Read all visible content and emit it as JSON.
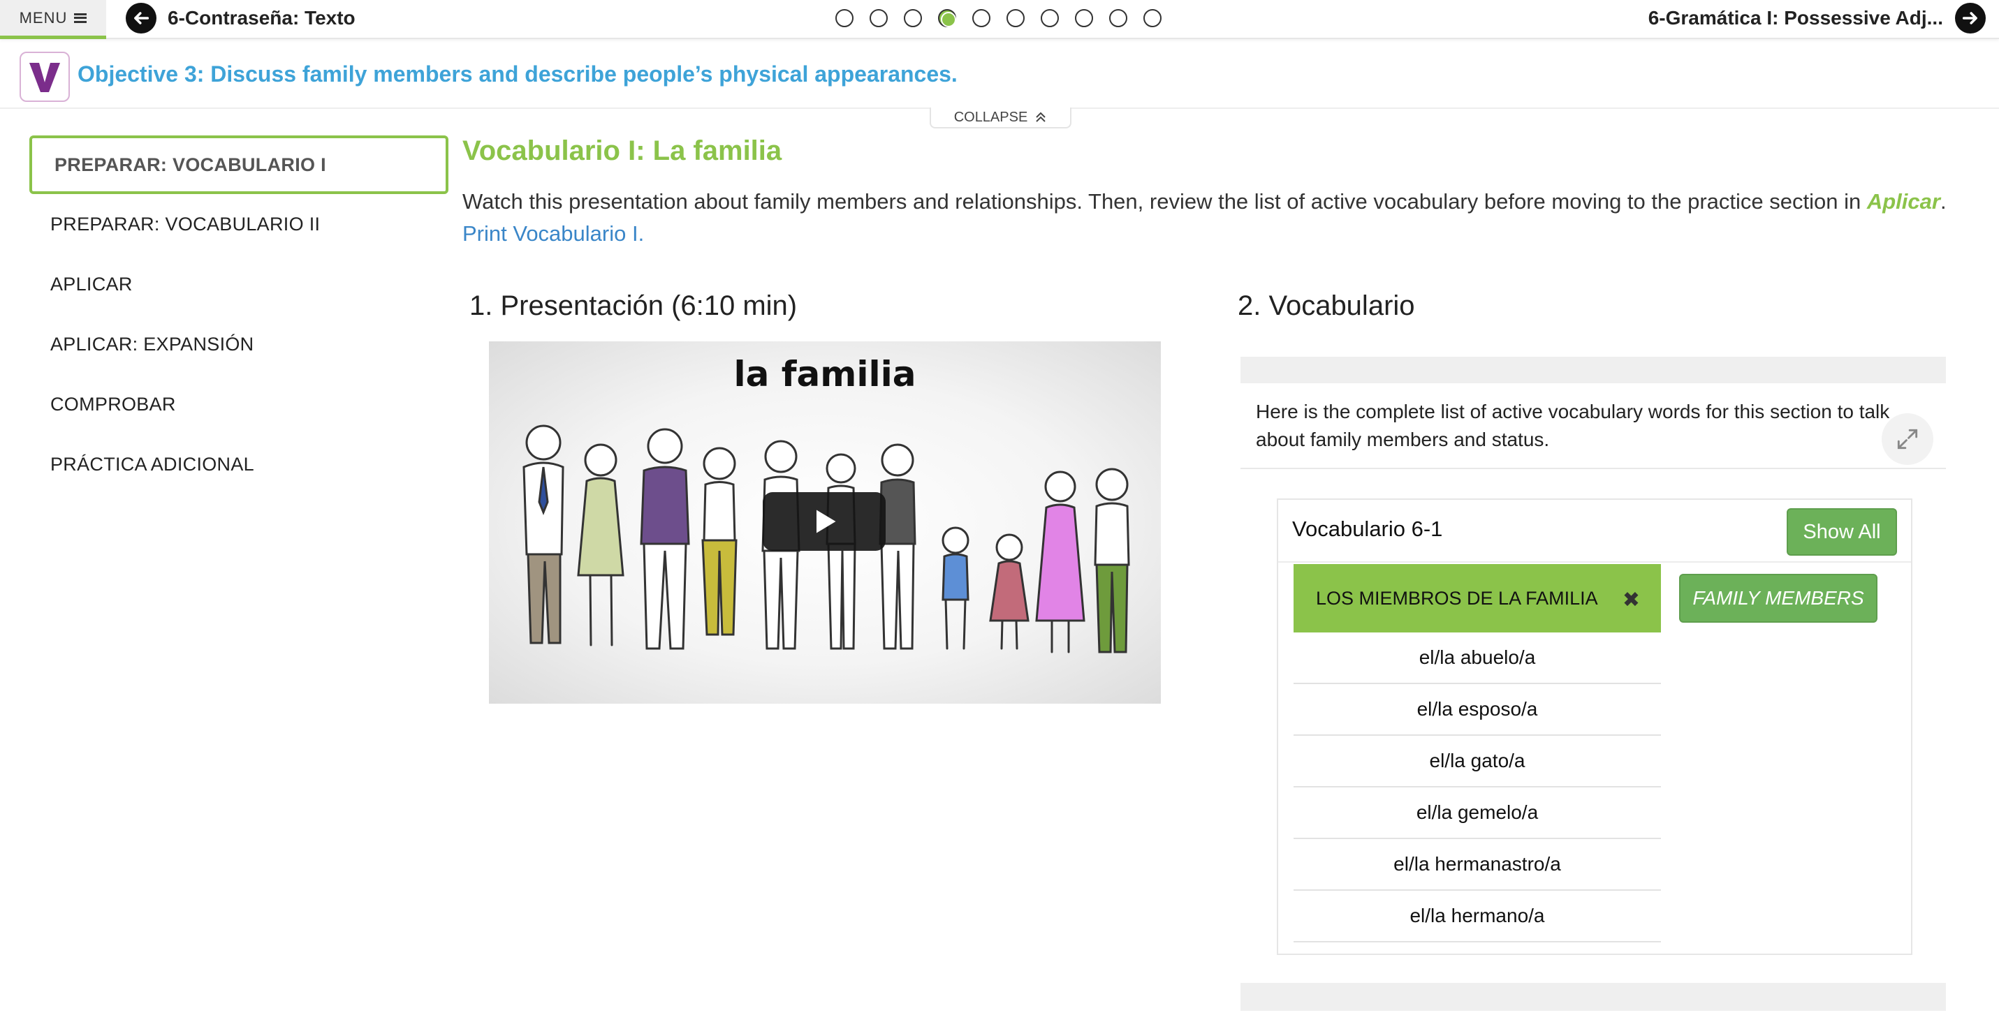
{
  "topbar": {
    "menu_label": "MENU",
    "prev_title": "6-Contraseña: Texto",
    "next_title": "6-Gramática I: Possessive Adj...",
    "progress": {
      "total": 10,
      "current": 4
    }
  },
  "objective": {
    "text": "Objective 3: Discuss family members and describe people’s physical appearances.",
    "logo_letter": "V",
    "collapse_label": "COLLAPSE"
  },
  "sidebar": {
    "items": [
      {
        "label": "PREPARAR: VOCABULARIO I",
        "active": true
      },
      {
        "label": "PREPARAR: VOCABULARIO II",
        "active": false
      },
      {
        "label": "APLICAR",
        "active": false
      },
      {
        "label": "APLICAR: EXPANSIÓN",
        "active": false
      },
      {
        "label": "COMPROBAR",
        "active": false
      },
      {
        "label": "PRÁCTICA ADICIONAL",
        "active": false
      }
    ]
  },
  "main": {
    "section_title": "Vocabulario I: La familia",
    "intro_text": "Watch this presentation about family members and relationships. Then, review the list of active vocabulary before moving to the practice section in ",
    "intro_aplicar": "Aplicar",
    "intro_period": ". ",
    "print_link": "Print Vocabulario I.",
    "presentation_heading": "1. Presentación (6:10 min)",
    "video_title": "la familia",
    "vocab_heading": "2. Vocabulario",
    "vocab_description": "Here is the complete list of active vocabulary words for this section to talk about family members and status.",
    "vocab_box": {
      "title": "Vocabulario 6-1",
      "show_all_label": "Show All",
      "category_label": "LOS MIEMBROS DE LA FAMILIA",
      "category_close": "✖",
      "category_translation": "FAMILY MEMBERS",
      "words": [
        "el/la abuelo/a",
        "el/la esposo/a",
        "el/la gato/a",
        "el/la gemelo/a",
        "el/la hermanastro/a",
        "el/la hermano/a"
      ]
    }
  },
  "colors": {
    "accent_green": "#8bc34a",
    "button_green": "#6cb159",
    "objective_blue": "#3ea3d8",
    "link_blue": "#3a86c8",
    "logo_purple": "#7b2d8b"
  },
  "icons": {
    "prev": "arrow-left-icon",
    "next": "arrow-right-icon",
    "menu": "hamburger-icon",
    "collapse": "chevron-double-up-icon",
    "expand": "expand-icon",
    "play": "play-icon",
    "close": "close-icon"
  }
}
